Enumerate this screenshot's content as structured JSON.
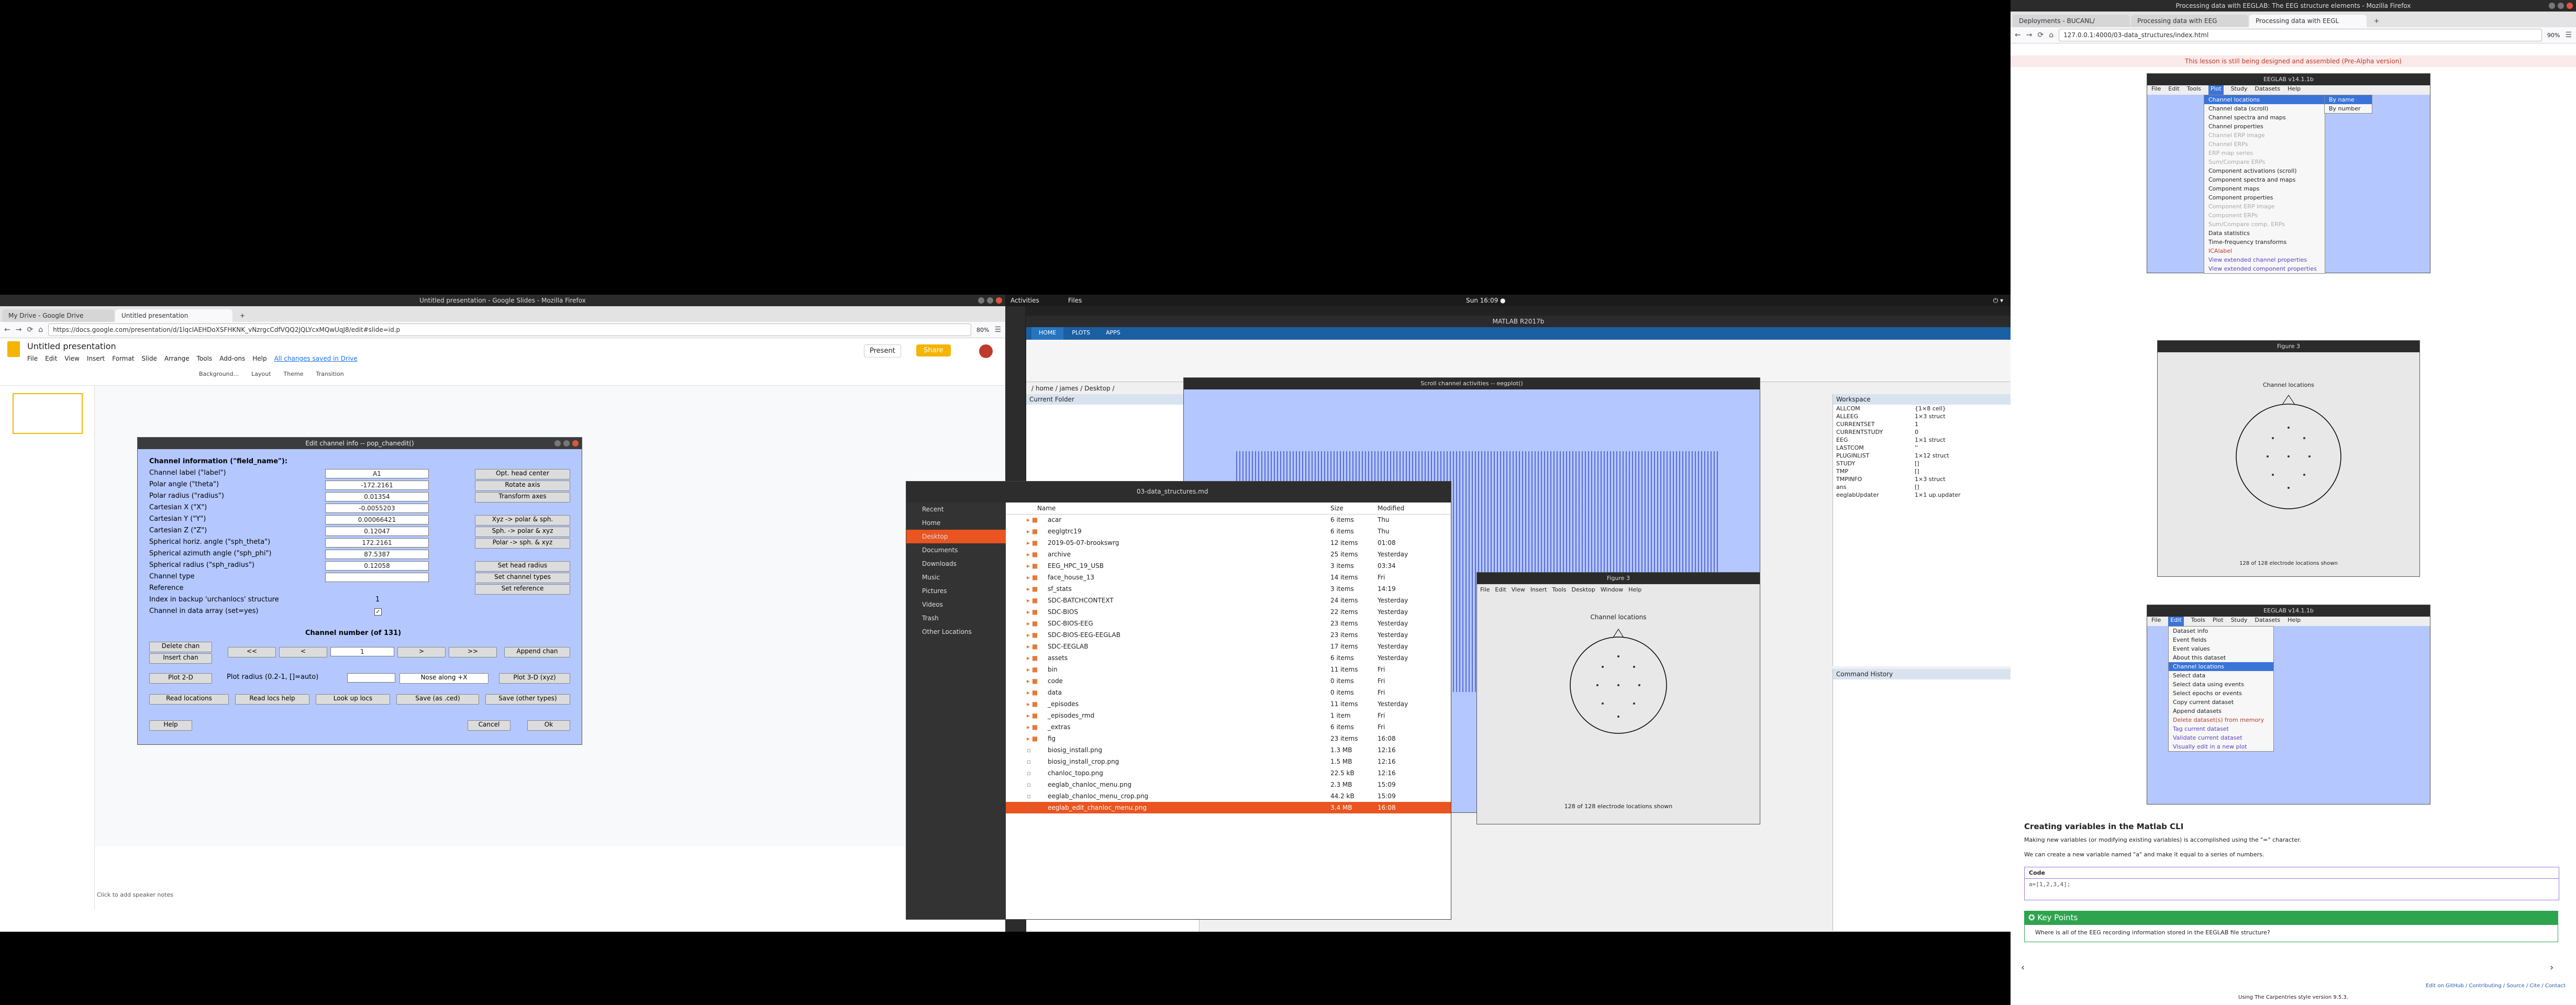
{
  "left_monitor": {
    "window_title": "Untitled presentation - Google Slides - Mozilla Firefox",
    "tabs": [
      {
        "label": "My Drive - Google Drive"
      },
      {
        "label": "Untitled presentation"
      }
    ],
    "url": "https://docs.google.com/presentation/d/1lqcIAEHDoXSFHKNK_vNzrgcCdfVQQ2JQLYcxMQwUqJ8/edit#slide=id.p",
    "zoom": "80%",
    "doc_title": "Untitled presentation",
    "menu": [
      "File",
      "Edit",
      "View",
      "Insert",
      "Format",
      "Slide",
      "Arrange",
      "Tools",
      "Add-ons",
      "Help"
    ],
    "last_edit": "All changes saved in Drive",
    "present_label": "Present",
    "share_label": "Share",
    "toolbar": [
      "Background...",
      "Layout",
      "Theme",
      "Transition"
    ],
    "notes_placeholder": "Click to add speaker notes"
  },
  "channel_dialog": {
    "title": "Edit channel info -- pop_chanedit()",
    "heading": "Channel information (\"field_name\"):",
    "rows": [
      {
        "label": "Channel label (\"label\")",
        "value": "A1"
      },
      {
        "label": "Polar angle (\"theta\")",
        "value": "-172.2161"
      },
      {
        "label": "Polar radius (\"radius\")",
        "value": "0.01354"
      },
      {
        "label": "Cartesian X (\"X\")",
        "value": "-0.0055203"
      },
      {
        "label": "Cartesian Y (\"Y\")",
        "value": "0.00066421"
      },
      {
        "label": "Cartesian Z (\"Z\")",
        "value": "0.12047"
      },
      {
        "label": "Spherical horiz. angle (\"sph_theta\")",
        "value": "172.2161"
      },
      {
        "label": "Spherical azimuth angle (\"sph_phi\")",
        "value": "87.5387"
      },
      {
        "label": "Spherical radius (\"sph_radius\")",
        "value": "0.12058"
      },
      {
        "label": "Channel type",
        "value": ""
      },
      {
        "label": "Reference",
        "value": ""
      },
      {
        "label": "Index in backup 'urchanlocs' structure",
        "value": "1"
      },
      {
        "label": "Channel in data array (set=yes)",
        "value": ""
      }
    ],
    "side_buttons": [
      "Opt. head center",
      "Rotate axis",
      "Transform axes",
      "Xyz -> polar & sph.",
      "Sph. -> polar & xyz",
      "Polar -> sph. & xyz",
      "Set head radius",
      "Set channel types",
      "Set reference"
    ],
    "channel_number_label": "Channel number (of 131)",
    "nav_buttons": [
      "Delete chan",
      "<<",
      "<",
      "1",
      ">",
      ">>",
      "Append chan"
    ],
    "insert_button": "Insert chan",
    "plot2d": "Plot 2-D",
    "plot_radius_label": "Plot radius (0.2-1, []=auto)",
    "nose_select": "Nose along +X",
    "plot3d": "Plot 3-D (xyz)",
    "bottom_buttons": [
      "Read locations",
      "Read locs help",
      "Look up locs",
      "Save (as .ced)",
      "Save (other types)"
    ],
    "help": "Help",
    "cancel": "Cancel",
    "ok": "Ok"
  },
  "ubuntu": {
    "activities": "Activities",
    "app_menu": "Files",
    "clock": "Sun 16:09 ●",
    "matlab_title": "MATLAB R2017b",
    "matlab_tabs": [
      "HOME",
      "PLOTS",
      "APPS"
    ],
    "matlab_path": "/ home / james / Desktop /",
    "current_folder": "Current Folder",
    "workspace": "Workspace",
    "workspace_vars": [
      {
        "name": "ALLCOM",
        "value": "{1×8 cell}"
      },
      {
        "name": "ALLEEG",
        "value": "1×3 struct"
      },
      {
        "name": "CURRENTSET",
        "value": "1"
      },
      {
        "name": "CURRENTSTUDY",
        "value": "0"
      },
      {
        "name": "EEG",
        "value": "1×1 struct"
      },
      {
        "name": "LASTCOM",
        "value": "''"
      },
      {
        "name": "PLUGINLIST",
        "value": "1×12 struct"
      },
      {
        "name": "STUDY",
        "value": "[]"
      },
      {
        "name": "TMP",
        "value": "[]"
      },
      {
        "name": "TMPINFO",
        "value": "1×3 struct"
      },
      {
        "name": "ans",
        "value": "[]"
      },
      {
        "name": "eeglabUpdater",
        "value": "1×1 up.updater"
      }
    ],
    "command_history": "Command History",
    "scroll_title": "Scroll channel activities -- eegplot()",
    "figure_title": "Figure 3",
    "figure_menu": [
      "File",
      "Edit",
      "View",
      "Insert",
      "Tools",
      "Desktop",
      "Window",
      "Help"
    ],
    "channel_locations": "Channel locations",
    "electrodes_shown": "128 of 128 electrode locations shown",
    "files_window_title": "03-data_structures.md",
    "files_sidebar": [
      "Recent",
      "Home",
      "Desktop",
      "Documents",
      "Downloads",
      "Music",
      "Pictures",
      "Videos",
      "Trash",
      "Other Locations"
    ],
    "files_columns": [
      "Name",
      "Size",
      "Modified"
    ],
    "files": [
      {
        "name": "acar",
        "size": "6 items",
        "mod": "Thu",
        "folder": true
      },
      {
        "name": "eeglgtrc19",
        "size": "6 items",
        "mod": "Thu",
        "folder": true
      },
      {
        "name": "2019-05-07-brookswrg",
        "size": "12 items",
        "mod": "01:08",
        "folder": true
      },
      {
        "name": "archive",
        "size": "25 items",
        "mod": "Yesterday",
        "folder": true
      },
      {
        "name": "EEG_HPC_19_USB",
        "size": "3 items",
        "mod": "03:34",
        "folder": true
      },
      {
        "name": "face_house_13",
        "size": "14 items",
        "mod": "Fri",
        "folder": true
      },
      {
        "name": "sf_stats",
        "size": "3 items",
        "mod": "14:19",
        "folder": true
      },
      {
        "name": "SDC-BATCHCONTEXT",
        "size": "24 items",
        "mod": "Yesterday",
        "folder": true
      },
      {
        "name": "SDC-BIOS",
        "size": "22 items",
        "mod": "Yesterday",
        "folder": true
      },
      {
        "name": "SDC-BIOS-EEG",
        "size": "23 items",
        "mod": "Yesterday",
        "folder": true
      },
      {
        "name": "SDC-BIOS-EEG-EEGLAB",
        "size": "23 items",
        "mod": "Yesterday",
        "folder": true
      },
      {
        "name": "SDC-EEGLAB",
        "size": "17 items",
        "mod": "Yesterday",
        "folder": true
      },
      {
        "name": "assets",
        "size": "6 items",
        "mod": "Yesterday",
        "folder": true
      },
      {
        "name": "bin",
        "size": "11 items",
        "mod": "Fri",
        "folder": true
      },
      {
        "name": "code",
        "size": "0 items",
        "mod": "Fri",
        "folder": true
      },
      {
        "name": "data",
        "size": "0 items",
        "mod": "Fri",
        "folder": true
      },
      {
        "name": "_episodes",
        "size": "11 items",
        "mod": "Yesterday",
        "folder": true
      },
      {
        "name": "_episodes_rmd",
        "size": "1 item",
        "mod": "Fri",
        "folder": true
      },
      {
        "name": "_extras",
        "size": "6 items",
        "mod": "Fri",
        "folder": true
      },
      {
        "name": "fig",
        "size": "23 items",
        "mod": "16:08",
        "folder": true
      },
      {
        "name": "biosig_install.png",
        "size": "1.3 MB",
        "mod": "12:16",
        "folder": false
      },
      {
        "name": "biosig_install_crop.png",
        "size": "1.5 MB",
        "mod": "12:16",
        "folder": false
      },
      {
        "name": "chanloc_topo.png",
        "size": "22.5 kB",
        "mod": "12:16",
        "folder": false
      },
      {
        "name": "eeglab_chanloc_menu.png",
        "size": "2.3 MB",
        "mod": "15:09",
        "folder": false
      },
      {
        "name": "eeglab_chanloc_menu_crop.png",
        "size": "44.2 kB",
        "mod": "15:09",
        "folder": false
      },
      {
        "name": "eeglab_edit_chanloc_menu.png",
        "size": "3.4 MB",
        "mod": "16:08",
        "folder": false
      }
    ]
  },
  "right_monitor": {
    "window_title": "Processing data with EEGLAB: The EEG structure elements - Mozilla Firefox",
    "tabs": [
      "Deployments - BUCANL/",
      "Processing data with EEG",
      "Processing data with EEGL"
    ],
    "url": "127.0.0.1:4000/03-data_structures/index.html",
    "zoom": "90%",
    "banner": "This lesson is still being designed and assembled (Pre-Alpha version)",
    "eeglab_title": "EEGLAB v14.1.1b",
    "eeglab_menu": [
      "File",
      "Edit",
      "Tools",
      "Plot",
      "Study",
      "Datasets",
      "Help"
    ],
    "plot_menu": [
      {
        "label": "Channel locations",
        "cls": "hl"
      },
      {
        "label": "Channel data (scroll)",
        "cls": ""
      },
      {
        "label": "Channel spectra and maps",
        "cls": ""
      },
      {
        "label": "Channel properties",
        "cls": ""
      },
      {
        "label": "Channel ERP image",
        "cls": "dis"
      },
      {
        "label": "Channel ERPs",
        "cls": "dis"
      },
      {
        "label": "ERP map series",
        "cls": "dis"
      },
      {
        "label": "Sum/Compare ERPs",
        "cls": "dis"
      },
      {
        "label": "Component activations (scroll)",
        "cls": ""
      },
      {
        "label": "Component spectra and maps",
        "cls": ""
      },
      {
        "label": "Component maps",
        "cls": ""
      },
      {
        "label": "Component properties",
        "cls": ""
      },
      {
        "label": "Component ERP image",
        "cls": "dis"
      },
      {
        "label": "Component ERPs",
        "cls": "dis"
      },
      {
        "label": "Sum/Compare comp. ERPs",
        "cls": "dis"
      },
      {
        "label": "Data statistics",
        "cls": ""
      },
      {
        "label": "Time-frequency transforms",
        "cls": ""
      },
      {
        "label": "ICAlabel",
        "cls": "red"
      },
      {
        "label": "View extended channel properties",
        "cls": "link"
      },
      {
        "label": "View extended component properties",
        "cls": "link"
      }
    ],
    "submenu": [
      "By name",
      "By number"
    ],
    "edit_menu": [
      {
        "label": "Dataset info",
        "cls": ""
      },
      {
        "label": "Event fields",
        "cls": ""
      },
      {
        "label": "Event values",
        "cls": ""
      },
      {
        "label": "About this dataset",
        "cls": ""
      },
      {
        "label": "Channel locations",
        "cls": "hl"
      },
      {
        "label": "Select data",
        "cls": ""
      },
      {
        "label": "Select data using events",
        "cls": ""
      },
      {
        "label": "Select epochs or events",
        "cls": ""
      },
      {
        "label": "Copy current dataset",
        "cls": ""
      },
      {
        "label": "Append datasets",
        "cls": ""
      },
      {
        "label": "Delete dataset(s) from memory",
        "cls": "red"
      },
      {
        "label": "Tag current dataset",
        "cls": "link"
      },
      {
        "label": "Validate current dataset",
        "cls": "link"
      },
      {
        "label": "Visually edit in a new plot",
        "cls": "link"
      }
    ],
    "figure3_title": "Figure 3",
    "figure3_channel_locations": "Channel locations",
    "figure3_shown": "128 of 128 electrode locations shown",
    "section_title": "Creating variables in the Matlab CLI",
    "para1": "Making new variables (or modifying existing variables) is accomplished using the \"=\" character.",
    "para2": "We can create a new variable named \"a\" and make it equal to a series of numbers.",
    "code_label": "Code",
    "code_text": "a=[1,2,3,4];",
    "keypoints_title": "Key Points",
    "keypoint": "Where is all of the EEG recording information stored in the EEGLAB file structure?",
    "footer_links": "Edit on GitHub / Contributing / Source / Cite / Contact",
    "footer_using": "Using The Carpentries style version 9.5.3."
  }
}
